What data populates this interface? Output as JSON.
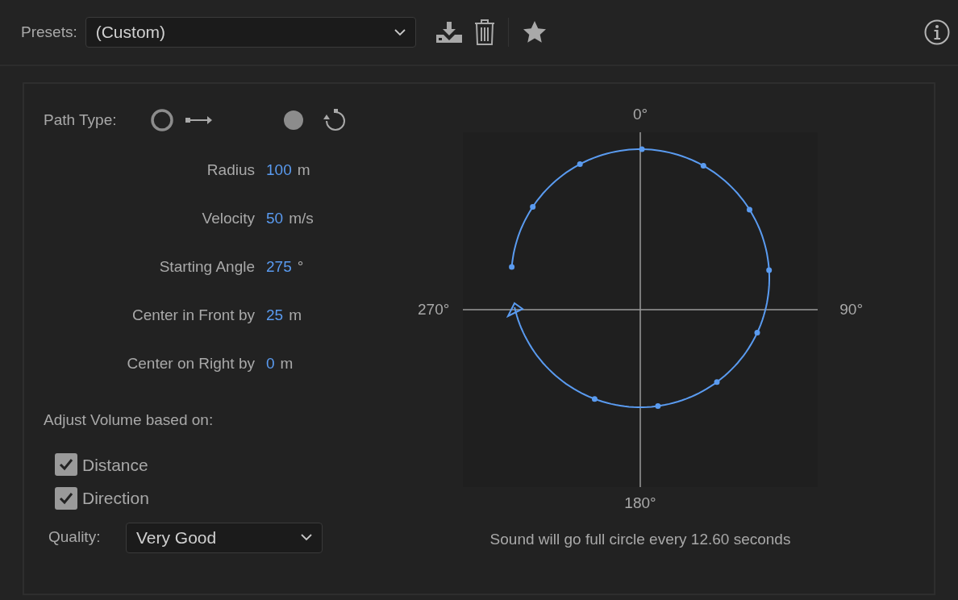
{
  "presets": {
    "label": "Presets:",
    "value": "(Custom)"
  },
  "path_type": {
    "label": "Path Type:"
  },
  "parameters": [
    {
      "label": "Radius",
      "value": "100",
      "unit": "m"
    },
    {
      "label": "Velocity",
      "value": "50",
      "unit": "m/s"
    },
    {
      "label": "Starting Angle",
      "value": "275",
      "unit": "°"
    },
    {
      "label": "Center in Front by",
      "value": "25",
      "unit": "m"
    },
    {
      "label": "Center on Right by",
      "value": "0",
      "unit": "m"
    }
  ],
  "adjust_volume": {
    "label": "Adjust Volume based on:",
    "options": [
      {
        "label": "Distance",
        "checked": true
      },
      {
        "label": "Direction",
        "checked": true
      }
    ]
  },
  "quality": {
    "label": "Quality:",
    "value": "Very Good"
  },
  "plot": {
    "top_label": "0°",
    "right_label": "90°",
    "bottom_label": "180°",
    "left_label": "270°",
    "caption": "Sound will go full circle every 12.60 seconds"
  }
}
